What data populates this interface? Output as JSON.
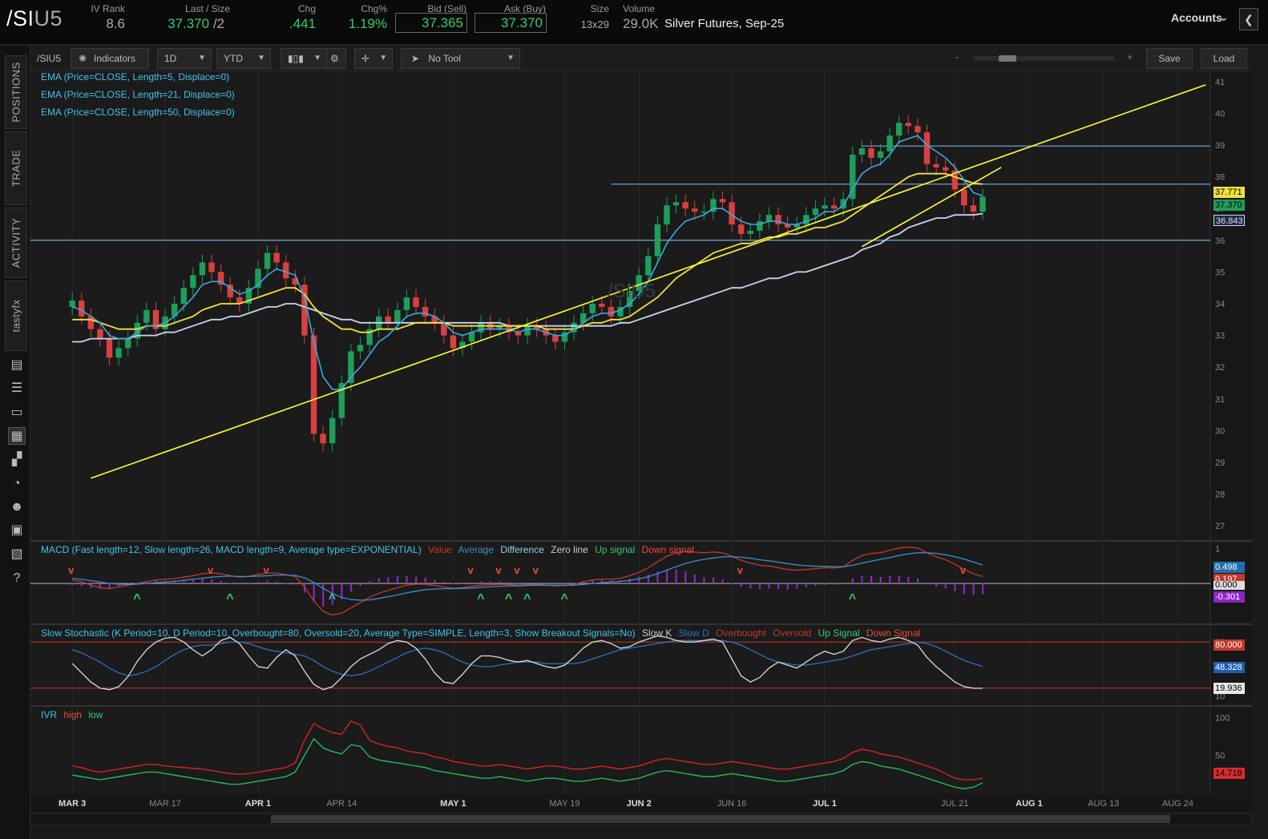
{
  "topbar": {
    "symbol_main": "/SI",
    "symbol_suffix": "U5",
    "iv_rank_label": "IV Rank",
    "iv_rank_value": "8.6",
    "last_size_label": "Last / Size",
    "last_value": "37.370",
    "size_value": "/2",
    "chg_label": "Chg",
    "chg_value": ".441",
    "chg_pct_label": "Chg%",
    "chg_pct_value": "1.19%",
    "bid_label": "Bid (Sell)",
    "bid_value": "37.365",
    "ask_label": "Ask (Buy)",
    "ask_value": "37.370",
    "size_label": "Size",
    "size_quote": "13x29",
    "volume_label": "Volume",
    "volume_value": "29.0K",
    "description": "Silver Futures, Sep-25",
    "accounts_label": "Accounts",
    "collapse_glyph": "❮"
  },
  "sidebar": {
    "tabs": [
      "POSITIONS",
      "TRADE",
      "ACTIVITY",
      "tastyfx"
    ],
    "icons": [
      "news-icon",
      "list-icon",
      "tv-icon",
      "chart-icon",
      "grid-icon",
      "gauge-icon",
      "community-icon",
      "calendar-icon",
      "fx-icon",
      "help-icon"
    ]
  },
  "toolbar": {
    "symbol": "/SIU5",
    "indicators_label": "Indicators",
    "interval": "1D",
    "range": "YTD",
    "tool_label": "No Tool",
    "zoom_minus": "-",
    "zoom_plus": "+",
    "save_label": "Save",
    "load_label": "Load"
  },
  "price_legends": [
    "EMA (Price=CLOSE, Length=5, Displace=0)",
    "EMA (Price=CLOSE, Length=21, Displace=0)",
    "EMA (Price=CLOSE, Length=50, Displace=0)"
  ],
  "watermark": "/SIU5",
  "macd_legend": {
    "main": "MACD (Fast length=12, Slow length=26, MACD length=9, Average type=EXPONENTIAL)",
    "value": "Value",
    "average": "Average",
    "difference": "Difference",
    "zero": "Zero line",
    "up": "Up signal",
    "down": "Down signal"
  },
  "stoch_legend": {
    "main": "Slow Stochastic (K Period=10, D Period=10, Overbought=80, Oversold=20, Average Type=SIMPLE, Length=3, Show Breakout Signals=No)",
    "k": "Slow K",
    "d": "Slow D",
    "overbought": "Overbought",
    "oversold": "Oversold",
    "up": "Up Signal",
    "down": "Down Signal"
  },
  "ivr_legend": {
    "main": "IVR",
    "high": "high",
    "low": "low"
  },
  "price_tags": {
    "ema21": "37.771",
    "last": "37.370",
    "ema50": "36.843",
    "macd_value": "0.498",
    "macd_avg": "0.197",
    "macd_zero": "0.000",
    "macd_diff": "-0.301",
    "stoch_ob": "80.000",
    "stoch_d": "48.328",
    "stoch_k": "19.936",
    "ivr": "14.718"
  },
  "colors": {
    "up_candle": "#1e9e5a",
    "down_candle": "#d9403f",
    "ema5": "#3aa8e0",
    "ema21": "#f2e13c",
    "ema50": "#c9d6ee",
    "trendline": "#ffff33",
    "hline": "#6f9fc4"
  },
  "chart_data": {
    "type": "candlestick",
    "price_axis": {
      "ticks": [
        27,
        28,
        29,
        30,
        31,
        32,
        33,
        34,
        35,
        36,
        37,
        38,
        39,
        40,
        41
      ],
      "ylim": [
        26.6,
        41.3
      ]
    },
    "date_ticks": [
      "MAR 3",
      "MAR 17",
      "APR 1",
      "APR 14",
      "MAY 1",
      "MAY 19",
      "JUN 2",
      "JUN 16",
      "JUL 1",
      "JUL 21",
      "AUG 1",
      "AUG 13",
      "AUG 24"
    ],
    "date_tick_index": [
      4,
      14,
      24,
      33,
      45,
      57,
      65,
      75,
      85,
      99,
      107,
      115,
      123
    ],
    "total_slots": 127,
    "horizontal_lines": [
      36.0,
      37.77,
      38.97
    ],
    "trendlines": [
      {
        "from": [
          2,
          28.5
        ],
        "to": [
          126,
          40.9
        ]
      },
      {
        "from": [
          85,
          35.8
        ],
        "to": [
          104,
          38.3
        ]
      }
    ],
    "closes": [
      34.1,
      33.6,
      33.2,
      32.9,
      32.3,
      32.6,
      32.9,
      33.4,
      33.8,
      33.2,
      33.6,
      34.0,
      34.5,
      34.9,
      35.3,
      35.0,
      34.6,
      34.2,
      34.0,
      34.5,
      35.1,
      35.6,
      35.3,
      34.8,
      34.6,
      33.0,
      29.9,
      29.6,
      30.4,
      31.5,
      32.5,
      32.7,
      33.2,
      33.6,
      33.4,
      33.8,
      34.2,
      33.9,
      33.6,
      33.4,
      33.0,
      32.6,
      32.8,
      33.1,
      33.4,
      33.2,
      33.3,
      33.1,
      33.0,
      33.3,
      33.2,
      33.0,
      32.8,
      33.1,
      33.4,
      33.7,
      34.0,
      33.9,
      33.6,
      33.9,
      34.4,
      34.9,
      35.5,
      36.5,
      37.1,
      37.2,
      37.0,
      36.9,
      36.9,
      37.3,
      37.2,
      36.5,
      36.2,
      36.3,
      36.6,
      36.8,
      36.5,
      36.4,
      36.5,
      36.8,
      37.0,
      37.1,
      37.0,
      37.3,
      38.7,
      38.9,
      38.6,
      38.8,
      39.3,
      39.7,
      39.6,
      39.4,
      38.4,
      38.3,
      38.2,
      37.6,
      37.1,
      36.9,
      37.37
    ],
    "ema5": [
      33.9,
      33.8,
      33.6,
      33.4,
      33.0,
      32.9,
      32.9,
      33.1,
      33.3,
      33.3,
      33.4,
      33.6,
      33.9,
      34.2,
      34.6,
      34.7,
      34.7,
      34.5,
      34.3,
      34.4,
      34.6,
      34.9,
      35.1,
      35.0,
      34.9,
      34.2,
      32.8,
      31.7,
      31.3,
      31.3,
      31.7,
      32.0,
      32.4,
      32.8,
      33.0,
      33.3,
      33.6,
      33.7,
      33.7,
      33.6,
      33.4,
      33.1,
      33.0,
      33.1,
      33.2,
      33.2,
      33.2,
      33.2,
      33.1,
      33.2,
      33.2,
      33.1,
      33.0,
      33.0,
      33.2,
      33.4,
      33.6,
      33.7,
      33.7,
      33.8,
      34.0,
      34.3,
      34.7,
      35.3,
      35.9,
      36.3,
      36.6,
      36.7,
      36.8,
      37.0,
      37.0,
      36.8,
      36.6,
      36.5,
      36.5,
      36.6,
      36.6,
      36.5,
      36.5,
      36.6,
      36.7,
      36.9,
      36.9,
      37.1,
      37.6,
      38.1,
      38.3,
      38.4,
      38.7,
      39.1,
      39.2,
      39.3,
      39.0,
      38.8,
      38.6,
      38.3,
      37.9,
      37.5,
      37.4
    ],
    "ema21": [
      33.5,
      33.5,
      33.5,
      33.4,
      33.3,
      33.2,
      33.2,
      33.2,
      33.3,
      33.3,
      33.3,
      33.4,
      33.5,
      33.6,
      33.8,
      33.9,
      34.0,
      34.0,
      34.0,
      34.1,
      34.2,
      34.3,
      34.4,
      34.5,
      34.5,
      34.3,
      33.9,
      33.6,
      33.4,
      33.2,
      33.2,
      33.1,
      33.1,
      33.2,
      33.2,
      33.2,
      33.3,
      33.4,
      33.4,
      33.4,
      33.4,
      33.3,
      33.3,
      33.3,
      33.3,
      33.3,
      33.3,
      33.3,
      33.3,
      33.3,
      33.3,
      33.2,
      33.2,
      33.2,
      33.2,
      33.3,
      33.4,
      33.4,
      33.5,
      33.5,
      33.6,
      33.8,
      34.0,
      34.2,
      34.5,
      34.8,
      35.0,
      35.2,
      35.4,
      35.6,
      35.7,
      35.8,
      35.9,
      35.9,
      36.0,
      36.1,
      36.1,
      36.2,
      36.2,
      36.3,
      36.4,
      36.4,
      36.5,
      36.6,
      36.8,
      37.0,
      37.2,
      37.4,
      37.6,
      37.8,
      38.0,
      38.1,
      38.1,
      38.1,
      38.1,
      38.0,
      37.9,
      37.8,
      37.77
    ],
    "ema50": [
      32.8,
      32.8,
      32.9,
      32.9,
      32.9,
      32.9,
      32.9,
      33.0,
      33.0,
      33.0,
      33.1,
      33.1,
      33.2,
      33.3,
      33.4,
      33.5,
      33.5,
      33.6,
      33.6,
      33.7,
      33.8,
      33.9,
      33.9,
      34.0,
      34.0,
      33.9,
      33.8,
      33.7,
      33.6,
      33.5,
      33.5,
      33.4,
      33.4,
      33.4,
      33.4,
      33.4,
      33.4,
      33.4,
      33.4,
      33.4,
      33.4,
      33.4,
      33.4,
      33.4,
      33.4,
      33.4,
      33.4,
      33.3,
      33.3,
      33.3,
      33.3,
      33.3,
      33.3,
      33.3,
      33.3,
      33.3,
      33.3,
      33.3,
      33.3,
      33.4,
      33.4,
      33.5,
      33.6,
      33.7,
      33.8,
      33.9,
      34.0,
      34.1,
      34.2,
      34.3,
      34.4,
      34.5,
      34.5,
      34.6,
      34.7,
      34.8,
      34.8,
      34.9,
      35.0,
      35.0,
      35.1,
      35.2,
      35.3,
      35.4,
      35.5,
      35.7,
      35.8,
      35.9,
      36.1,
      36.2,
      36.4,
      36.5,
      36.6,
      36.7,
      36.7,
      36.8,
      36.8,
      36.8,
      36.84
    ],
    "macd_axis": {
      "ticks": [
        1,
        0
      ],
      "ylim": [
        -1.1,
        1.15
      ]
    },
    "macd_value": [
      0.1,
      0.05,
      -0.05,
      -0.12,
      -0.15,
      -0.1,
      -0.05,
      0.0,
      0.05,
      0.1,
      0.12,
      0.14,
      0.18,
      0.22,
      0.28,
      0.3,
      0.28,
      0.22,
      0.18,
      0.2,
      0.26,
      0.3,
      0.3,
      0.25,
      0.2,
      -0.1,
      -0.5,
      -0.8,
      -0.9,
      -0.85,
      -0.7,
      -0.55,
      -0.4,
      -0.28,
      -0.2,
      -0.12,
      -0.05,
      -0.02,
      -0.02,
      -0.06,
      -0.1,
      -0.14,
      -0.12,
      -0.08,
      -0.05,
      -0.04,
      -0.02,
      -0.03,
      -0.05,
      -0.03,
      -0.02,
      -0.05,
      -0.07,
      -0.06,
      -0.02,
      0.04,
      0.1,
      0.12,
      0.12,
      0.15,
      0.22,
      0.32,
      0.45,
      0.62,
      0.78,
      0.88,
      0.92,
      0.9,
      0.88,
      0.9,
      0.88,
      0.78,
      0.66,
      0.58,
      0.52,
      0.5,
      0.45,
      0.4,
      0.38,
      0.4,
      0.42,
      0.45,
      0.44,
      0.48,
      0.66,
      0.8,
      0.86,
      0.88,
      0.95,
      1.02,
      1.04,
      1.02,
      0.88,
      0.76,
      0.68,
      0.55,
      0.4,
      0.28,
      0.2
    ],
    "macd_avg": [
      0.15,
      0.12,
      0.08,
      0.04,
      0.0,
      -0.02,
      -0.03,
      -0.02,
      0.0,
      0.02,
      0.04,
      0.06,
      0.09,
      0.12,
      0.15,
      0.18,
      0.2,
      0.21,
      0.2,
      0.2,
      0.21,
      0.22,
      0.24,
      0.24,
      0.23,
      0.16,
      0.03,
      -0.14,
      -0.29,
      -0.4,
      -0.46,
      -0.48,
      -0.47,
      -0.43,
      -0.38,
      -0.33,
      -0.27,
      -0.22,
      -0.18,
      -0.16,
      -0.15,
      -0.15,
      -0.14,
      -0.13,
      -0.11,
      -0.1,
      -0.08,
      -0.07,
      -0.07,
      -0.06,
      -0.05,
      -0.05,
      -0.05,
      -0.05,
      -0.05,
      -0.03,
      0.0,
      0.02,
      0.04,
      0.06,
      0.09,
      0.13,
      0.19,
      0.28,
      0.38,
      0.48,
      0.57,
      0.64,
      0.69,
      0.73,
      0.76,
      0.77,
      0.75,
      0.72,
      0.68,
      0.65,
      0.61,
      0.57,
      0.53,
      0.51,
      0.49,
      0.49,
      0.48,
      0.48,
      0.52,
      0.58,
      0.64,
      0.69,
      0.74,
      0.8,
      0.85,
      0.88,
      0.88,
      0.86,
      0.82,
      0.77,
      0.7,
      0.61,
      0.53
    ],
    "macd_diff": [
      -0.05,
      -0.07,
      -0.13,
      -0.16,
      -0.15,
      -0.08,
      -0.02,
      0.02,
      0.05,
      0.08,
      0.08,
      0.08,
      0.09,
      0.1,
      0.13,
      0.12,
      0.08,
      0.01,
      -0.02,
      0.0,
      0.05,
      0.08,
      0.06,
      0.01,
      -0.03,
      -0.26,
      -0.53,
      -0.66,
      -0.61,
      -0.45,
      -0.24,
      -0.07,
      0.07,
      0.15,
      0.18,
      0.21,
      0.22,
      0.2,
      0.16,
      0.1,
      0.05,
      0.01,
      0.02,
      0.05,
      0.06,
      0.06,
      0.06,
      0.04,
      0.02,
      0.03,
      0.03,
      0.0,
      -0.02,
      -0.01,
      0.03,
      0.07,
      0.1,
      0.1,
      0.08,
      0.09,
      0.13,
      0.19,
      0.26,
      0.34,
      0.4,
      0.4,
      0.35,
      0.26,
      0.19,
      0.17,
      0.12,
      0.01,
      -0.09,
      -0.14,
      -0.16,
      -0.15,
      -0.16,
      -0.17,
      -0.15,
      -0.11,
      -0.07,
      -0.04,
      -0.04,
      0.0,
      0.14,
      0.22,
      0.22,
      0.19,
      0.21,
      0.22,
      0.19,
      0.14,
      0.0,
      -0.1,
      -0.14,
      -0.22,
      -0.3,
      -0.33,
      -0.3
    ],
    "macd_up_signals": [
      7,
      17,
      28,
      44,
      47,
      49,
      53,
      84
    ],
    "macd_down_signals": [
      0,
      15,
      21,
      43,
      46,
      48,
      50,
      72,
      96
    ],
    "stoch_axis": {
      "ticks": [
        80,
        10
      ],
      "ylim": [
        0,
        100
      ]
    },
    "stoch_k": [
      52,
      40,
      28,
      20,
      18,
      22,
      35,
      55,
      70,
      80,
      85,
      86,
      80,
      70,
      62,
      70,
      82,
      86,
      78,
      62,
      48,
      46,
      60,
      70,
      62,
      42,
      25,
      18,
      22,
      34,
      48,
      58,
      64,
      70,
      78,
      82,
      80,
      72,
      58,
      40,
      28,
      26,
      38,
      52,
      62,
      62,
      60,
      56,
      54,
      56,
      52,
      48,
      46,
      50,
      60,
      72,
      80,
      82,
      78,
      72,
      74,
      80,
      84,
      88,
      86,
      82,
      80,
      80,
      82,
      84,
      80,
      58,
      36,
      28,
      34,
      46,
      54,
      50,
      46,
      54,
      62,
      68,
      64,
      68,
      82,
      86,
      82,
      80,
      84,
      86,
      82,
      76,
      60,
      48,
      38,
      28,
      22,
      20,
      19.9
    ],
    "stoch_d": [
      70,
      66,
      60,
      54,
      46,
      40,
      36,
      38,
      42,
      48,
      56,
      64,
      70,
      74,
      76,
      76,
      78,
      80,
      80,
      78,
      74,
      70,
      68,
      66,
      64,
      62,
      56,
      48,
      42,
      38,
      36,
      38,
      42,
      48,
      54,
      60,
      66,
      70,
      72,
      70,
      66,
      60,
      54,
      50,
      48,
      48,
      50,
      52,
      54,
      54,
      54,
      52,
      52,
      52,
      52,
      54,
      58,
      62,
      66,
      70,
      72,
      74,
      76,
      78,
      80,
      82,
      82,
      82,
      82,
      82,
      82,
      80,
      76,
      70,
      64,
      58,
      54,
      52,
      50,
      50,
      52,
      54,
      56,
      58,
      62,
      66,
      70,
      72,
      74,
      76,
      78,
      80,
      78,
      74,
      68,
      62,
      56,
      52,
      48.3
    ],
    "ivr_axis": {
      "ticks": [
        100,
        50
      ],
      "ylim": [
        0,
        112
      ]
    },
    "ivr_high": [
      36,
      34,
      30,
      28,
      30,
      32,
      34,
      36,
      38,
      38,
      36,
      35,
      34,
      33,
      32,
      30,
      28,
      26,
      25,
      26,
      28,
      30,
      32,
      34,
      40,
      70,
      92,
      85,
      80,
      78,
      95,
      90,
      70,
      65,
      62,
      60,
      56,
      54,
      52,
      48,
      46,
      42,
      40,
      38,
      36,
      36,
      38,
      36,
      34,
      32,
      34,
      36,
      36,
      34,
      32,
      32,
      34,
      36,
      34,
      32,
      34,
      36,
      40,
      44,
      46,
      44,
      42,
      40,
      38,
      38,
      40,
      42,
      40,
      38,
      36,
      34,
      32,
      32,
      34,
      36,
      38,
      40,
      42,
      46,
      54,
      58,
      56,
      52,
      50,
      48,
      44,
      40,
      36,
      32,
      26,
      20,
      18,
      18,
      20
    ],
    "ivr_low": [
      24,
      22,
      20,
      18,
      20,
      22,
      24,
      26,
      28,
      28,
      26,
      24,
      22,
      20,
      18,
      16,
      14,
      12,
      12,
      14,
      16,
      18,
      20,
      22,
      28,
      50,
      72,
      60,
      55,
      52,
      64,
      62,
      48,
      44,
      42,
      40,
      38,
      36,
      34,
      30,
      28,
      26,
      24,
      22,
      20,
      20,
      22,
      20,
      18,
      16,
      18,
      20,
      20,
      18,
      16,
      16,
      18,
      20,
      18,
      16,
      18,
      20,
      24,
      28,
      30,
      28,
      26,
      24,
      22,
      22,
      24,
      26,
      24,
      22,
      20,
      18,
      16,
      16,
      18,
      20,
      22,
      24,
      26,
      30,
      38,
      42,
      40,
      36,
      34,
      32,
      28,
      24,
      20,
      16,
      12,
      8,
      6,
      8,
      14
    ]
  }
}
